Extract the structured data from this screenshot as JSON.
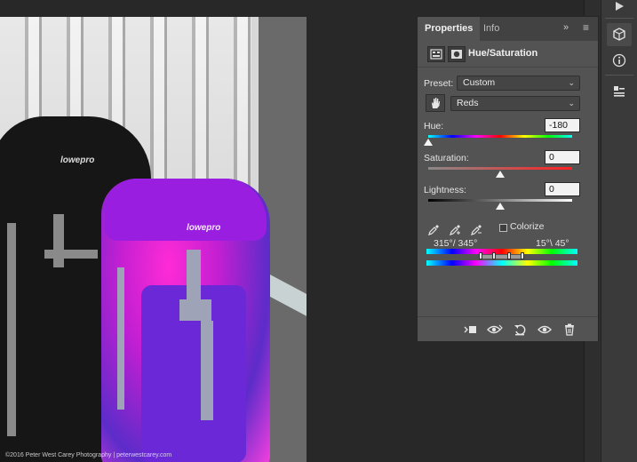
{
  "panel": {
    "tabs": [
      {
        "label": "Properties"
      },
      {
        "label": "Info"
      }
    ],
    "collapse_glyph": "»",
    "menu_glyph": "≡",
    "title": "Hue/Saturation",
    "preset_label": "Preset:",
    "preset_value": "Custom",
    "channel_value": "Reds",
    "hue_label": "Hue:",
    "hue_value": "-180",
    "saturation_label": "Saturation:",
    "saturation_value": "0",
    "lightness_label": "Lightness:",
    "lightness_value": "0",
    "colorize_label": "Colorize",
    "range_left": "315°/ 345°",
    "range_right": "15°\\ 45°",
    "hue_level": 0.0,
    "saturation_level": 0.5,
    "lightness_level": 0.5
  },
  "canvas": {
    "watermark": "©2016 Peter West Carey Photography | peterwestcarey.com",
    "logo_text": "lowepro"
  },
  "colors": {
    "panel_bg": "#535353",
    "tabbar_bg": "#424242",
    "workspace_bg": "#282828"
  },
  "icons": {
    "dock": [
      "play-icon",
      "3d-cube-icon",
      "info-icon",
      "properties-icon"
    ],
    "footer": [
      "clip-to-layer-icon",
      "view-previous-state-icon",
      "reset-icon",
      "visibility-icon",
      "delete-icon"
    ],
    "tools": [
      "eyedropper-icon",
      "eyedropper-plus-icon",
      "eyedropper-minus-icon",
      "hand-target-icon"
    ]
  }
}
